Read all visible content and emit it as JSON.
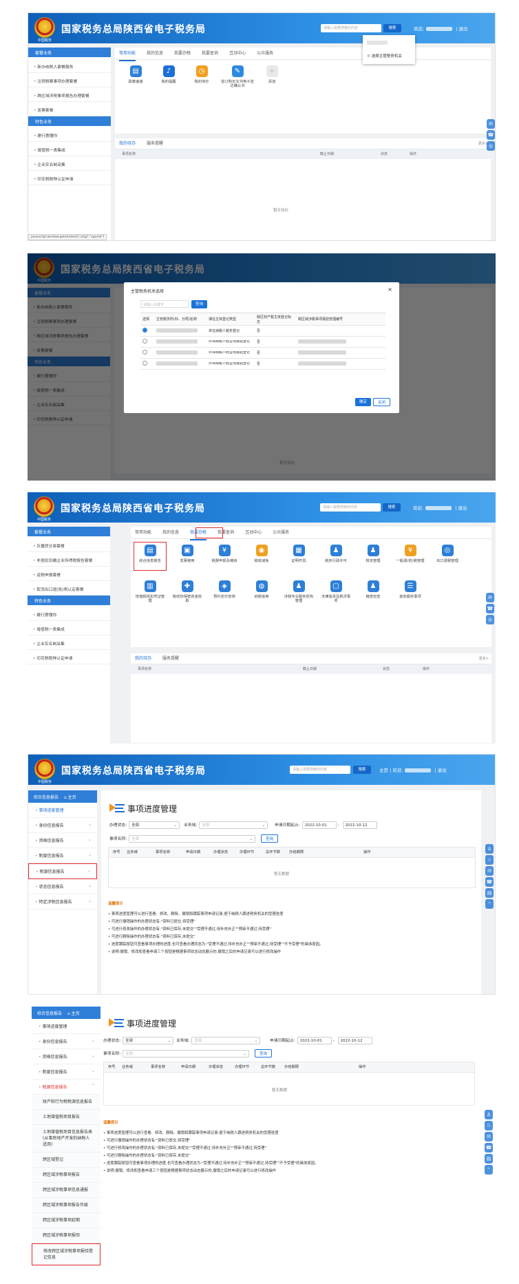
{
  "site_title": "国家税务总局陕西省电子税务局",
  "emblem_text": "中国税务",
  "search_placeholder": "请输入需要搜索的内容",
  "search_btn": "搜索",
  "welcome": "欢迎,",
  "logout": "退出",
  "home": "主页",
  "tabs": [
    "常用功能",
    "我的信息",
    "我要办税",
    "我要查询",
    "互动中心",
    "公众服务"
  ],
  "sidebar_head": "套餐业务",
  "sidebar_items": [
    "新办纳税人套餐服务",
    "注销税票事项办理套餐",
    "跨区域涉税事项报告办理套餐",
    "发票套餐"
  ],
  "sidebar_items_p3": [
    "存量房交易套餐",
    "非居民扣缴企业所得税报告套餐",
    "返税申报套餐",
    "取消出口退(免)税认定套餐"
  ],
  "special_head": "特色业务",
  "special_items": [
    "建行惠懂你",
    "增值税一表集成",
    "企业实名制采集",
    "印花税税种认定申请"
  ],
  "p1_icons": [
    "政策速递",
    "我的提醒",
    "我的待办",
    "签订购买文书电子送达确认书",
    "添加"
  ],
  "popup_item": "选择主管税务机关",
  "todo_tabs": [
    "我的待办",
    "服务提醒"
  ],
  "todo_more": "更多>",
  "todo_cols": [
    "事项名称",
    "截止日期",
    "状态",
    "操作"
  ],
  "no_todo": "暂无待办",
  "status_url": "javascript:window.gotoIndex(0,\"yhgl\",\"sgnmk\")",
  "dialog": {
    "title": "主管税务机关选择",
    "input_placeholder": "请输入关键字",
    "query": "查询",
    "cols": [
      "选择",
      "主管税务所(科、分局)名称",
      "课征主体登记类型",
      "跨区财产税主体登记标志",
      "跨区域涉税事项报验管理编号"
    ],
    "rows": [
      {
        "type": "单位纳税人税务登记",
        "flag": "否"
      },
      {
        "type": "外埠纳税人经营地报验登记",
        "flag": "否"
      },
      {
        "type": "外埠纳税人经营地报验登记",
        "flag": "否"
      },
      {
        "type": "外埠纳税人经营地报验登记",
        "flag": "否"
      }
    ],
    "ok": "确定",
    "close": "关闭"
  },
  "p3_icons": [
    "综合信息报告",
    "发票使用",
    "税费申报及缴纳",
    "税收减免",
    "证明开具",
    "税务行政许可",
    "核定管理",
    "一般退(抵)税管理",
    "出口退税管理",
    "增值税抵扣凭证管理",
    "税收协保管资金收取",
    "预约定价安排",
    "纳税信用",
    "涉税专业服务机构管理",
    "法律追责及救济事项",
    "稽查检查",
    "其他服务事项"
  ],
  "left_menu_head": "综合信息报告",
  "left_menu_p4": [
    "事项进度管理",
    "身份信息报告",
    "资格信息报告",
    "制度信息报告",
    "税源信息报告",
    "状态信息报告",
    "特定涉税信息报告"
  ],
  "left_menu_p5_top": [
    "事项进度管理",
    "身份信息报告",
    "资格信息报告",
    "制度信息报告",
    "税源信息报告"
  ],
  "left_menu_p5_sub": [
    "财产和行为税税源信息报告",
    "土地增值税项目报告",
    "土地增值税项目信息报告表(从事房地产开发的纳税人适用)",
    "跨区域登记",
    "跨区域涉税事项报告",
    "跨区域涉税事项信息通报",
    "跨区域涉税事项报告作废",
    "跨区域涉税事项延期",
    "跨区域涉税事项报验",
    "修改跨区域涉税事项报验登记信息"
  ],
  "progress_title": "事项进度管理",
  "filters": {
    "status_label": "办理状态:",
    "status_value": "全部",
    "biz_label": "业务域:",
    "biz_value": "全部",
    "date_label": "申请日期起止:",
    "date_from": "2022-10-01",
    "date_to": "2022-10-12",
    "dash": "-",
    "item_label": "事项名称:",
    "item_value": "全部",
    "query": "查询"
  },
  "result_cols": [
    "序号",
    "业务域",
    "事项名称",
    "申请日期",
    "办理状态",
    "办理环节",
    "总环节数",
    "办结期限",
    "操作"
  ],
  "no_data": "暂无数据",
  "tips_title": "温馨提示",
  "tips": [
    "事项进度管理可以进行查看、修改、删除、撤销和跟踪事项申请记录,便于纳税人跟进税务机关的受理进度",
    "可进行撤销操作的办理状态有:\"资料已提交,待受理\"",
    "可进行修改操作的办理状态有:\"资料已保存,未提交\"\"受理不通过,待补充补正\"\"预审不通过,待受理\"",
    "可进行删除操作的办理状态有:\"资料已保存,未提交\"",
    "进度跟踪按钮可查看事项办理的进度,也可查看办理状态为:\"受理不通过,待补充补正\"\"预审不通过,待受理\"\"不予受理\"的具体原因。",
    "说明:撤销、修改和查看申请三个按钮是根据事项状态动态展示的,撤销之后的申请记录可以进行修改操作"
  ]
}
